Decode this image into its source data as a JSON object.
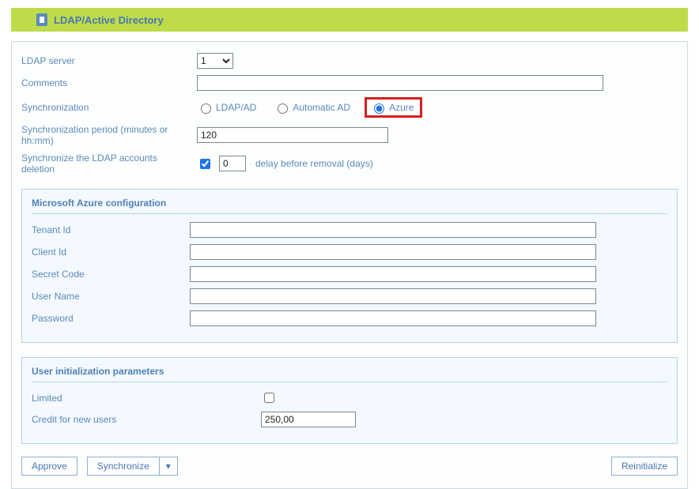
{
  "header": {
    "title": "LDAP/Active Directory"
  },
  "form": {
    "ldap_server_label": "LDAP server",
    "ldap_server_value": "1",
    "comments_label": "Comments",
    "comments_value": "",
    "sync_label": "Synchronization",
    "sync_options": {
      "ldap_ad": "LDAP/AD",
      "automatic_ad": "Automatic AD",
      "azure": "Azure"
    },
    "sync_selected": "azure",
    "sync_period_label": "Synchronization period (minutes or hh:mm)",
    "sync_period_value": "120",
    "sync_delete_label": "Synchronize the LDAP accounts deletion",
    "sync_delete_checked": true,
    "delay_value": "0",
    "delay_text": "delay before removal (days)"
  },
  "azure": {
    "section_title": "Microsoft Azure configuration",
    "tenant_label": "Tenant Id",
    "tenant_value": "",
    "client_label": "Client Id",
    "client_value": "",
    "secret_label": "Secret Code",
    "secret_value": "",
    "username_label": "User Name",
    "username_value": "",
    "password_label": "Password",
    "password_value": ""
  },
  "userinit": {
    "section_title": "User initialization parameters",
    "limited_label": "Limited",
    "limited_checked": false,
    "credit_label": "Credit for new users",
    "credit_value": "250,00"
  },
  "buttons": {
    "approve": "Approve",
    "synchronize": "Synchronize",
    "reinitialize": "Reinitialize"
  }
}
